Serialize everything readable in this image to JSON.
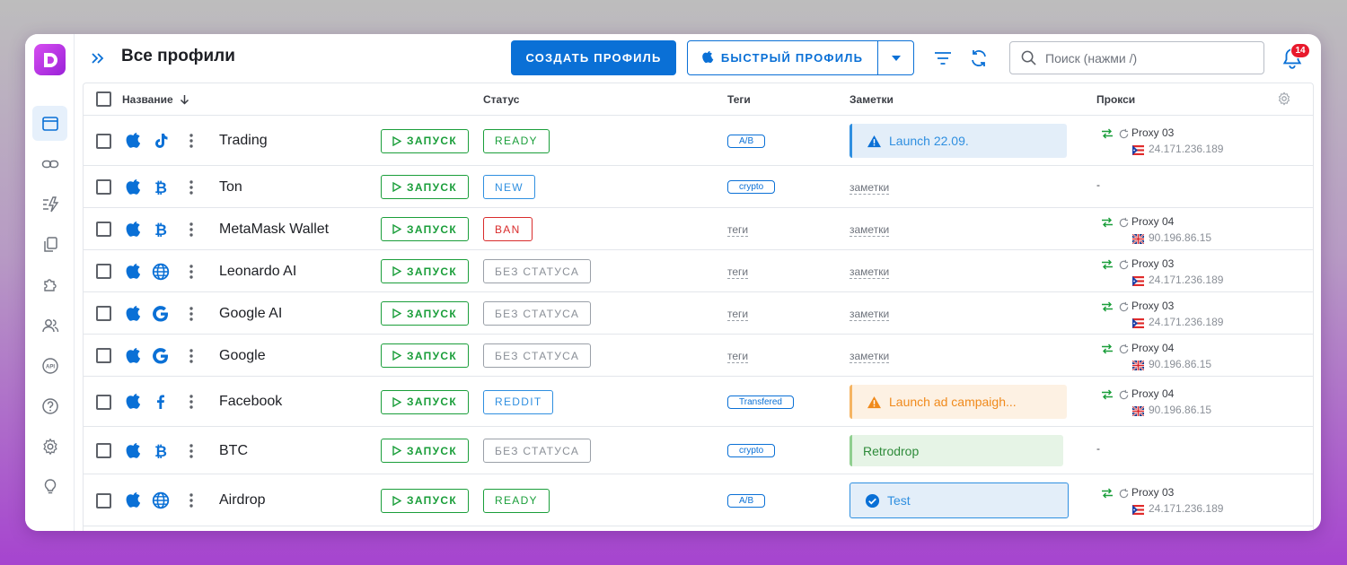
{
  "header": {
    "title": "Все профили",
    "create_label": "СОЗДАТЬ ПРОФИЛЬ",
    "quick_label": "БЫСТРЫЙ ПРОФИЛЬ",
    "search_placeholder": "Поиск (нажми /)",
    "notifications_count": "14"
  },
  "sidebar": {
    "items": [
      "profiles-icon",
      "link-icon",
      "automation-icon",
      "copy-icon",
      "extensions-icon",
      "users-icon",
      "api-icon",
      "help-icon",
      "settings-icon",
      "lightbulb-icon"
    ],
    "active": "profiles-icon"
  },
  "table": {
    "columns": {
      "name": "Название",
      "status": "Статус",
      "tags": "Теги",
      "notes": "Заметки",
      "proxy": "Прокси"
    },
    "run_label": "ЗАПУСК",
    "rows": [
      {
        "os_icon": "apple-icon",
        "type_icon": "tiktok-icon",
        "name": "Trading",
        "status": "READY",
        "status_kind": "green",
        "tag": "A/B",
        "tag_kind": "badge",
        "note": "Launch 22.09.",
        "note_kind": "info",
        "proxy_name": "Proxy 03",
        "proxy_ip": "24.171.236.189",
        "proxy_flag": "pr"
      },
      {
        "os_icon": "apple-icon",
        "type_icon": "bitcoin-icon",
        "name": "Ton",
        "status": "NEW",
        "status_kind": "blue",
        "tag": "crypto",
        "tag_kind": "badge",
        "note": "заметки",
        "note_kind": "empty",
        "proxy_name": "-",
        "proxy_ip": "",
        "proxy_flag": ""
      },
      {
        "os_icon": "apple-icon",
        "type_icon": "bitcoin-icon",
        "name": "MetaMask Wallet",
        "status": "BAN",
        "status_kind": "red",
        "tag": "теги",
        "tag_kind": "empty",
        "note": "заметки",
        "note_kind": "empty",
        "proxy_name": "Proxy 04",
        "proxy_ip": "90.196.86.15",
        "proxy_flag": "uk"
      },
      {
        "os_icon": "apple-icon",
        "type_icon": "globe-icon",
        "name": "Leonardo AI",
        "status": "БЕЗ СТАТУСА",
        "status_kind": "grey",
        "tag": "теги",
        "tag_kind": "empty",
        "note": "заметки",
        "note_kind": "empty",
        "proxy_name": "Proxy 03",
        "proxy_ip": "24.171.236.189",
        "proxy_flag": "pr"
      },
      {
        "os_icon": "apple-icon",
        "type_icon": "google-icon",
        "name": "Google AI",
        "status": "БЕЗ СТАТУСА",
        "status_kind": "grey",
        "tag": "теги",
        "tag_kind": "empty",
        "note": "заметки",
        "note_kind": "empty",
        "proxy_name": "Proxy 03",
        "proxy_ip": "24.171.236.189",
        "proxy_flag": "pr"
      },
      {
        "os_icon": "apple-icon",
        "type_icon": "google-icon",
        "name": "Google",
        "status": "БЕЗ СТАТУСА",
        "status_kind": "grey",
        "tag": "теги",
        "tag_kind": "empty",
        "note": "заметки",
        "note_kind": "empty",
        "proxy_name": "Proxy 04",
        "proxy_ip": "90.196.86.15",
        "proxy_flag": "uk"
      },
      {
        "os_icon": "apple-icon",
        "type_icon": "facebook-icon",
        "name": "Facebook",
        "status": "REDDIT",
        "status_kind": "blue",
        "tag": "Transfered",
        "tag_kind": "badge",
        "note": "Launch ad campaigh...",
        "note_kind": "warning",
        "proxy_name": "Proxy 04",
        "proxy_ip": "90.196.86.15",
        "proxy_flag": "uk"
      },
      {
        "os_icon": "apple-icon",
        "type_icon": "bitcoin-icon",
        "name": "BTC",
        "status": "БЕЗ СТАТУСА",
        "status_kind": "grey",
        "tag": "crypto",
        "tag_kind": "badge",
        "note": "Retrodrop",
        "note_kind": "success",
        "proxy_name": "-",
        "proxy_ip": "",
        "proxy_flag": ""
      },
      {
        "os_icon": "apple-icon",
        "type_icon": "globe-icon",
        "name": "Airdrop",
        "status": "READY",
        "status_kind": "green",
        "tag": "A/B",
        "tag_kind": "badge",
        "note": "Test",
        "note_kind": "done",
        "proxy_name": "Proxy 03",
        "proxy_ip": "24.171.236.189",
        "proxy_flag": "pr"
      }
    ]
  },
  "colors": {
    "accent": "#0a70d6",
    "run_green": "#1a9e3a",
    "ban_red": "#d92c2c",
    "badge_red": "#e8192c"
  }
}
